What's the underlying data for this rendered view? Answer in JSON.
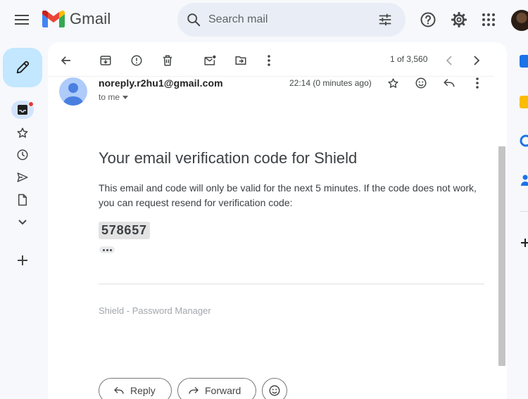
{
  "header": {
    "app_name": "Gmail",
    "search_placeholder": "Search mail"
  },
  "toolbar": {
    "counter": "1 of 3,560"
  },
  "message": {
    "sender": "noreply.r2hu1@gmail.com",
    "recipient_label": "to me",
    "timestamp": "22:14 (0 minutes ago)",
    "subject": "Your email verification code for Shield",
    "body": "This email and code will only be valid for the next 5 minutes. If the code does not work, you can request resend for verification code:",
    "code": "578657",
    "footer": "Shield - Password Manager"
  },
  "actions": {
    "reply_label": "Reply",
    "forward_label": "Forward"
  },
  "colors": {
    "page_bg": "#f6f8fc",
    "compose_bg": "#c2e7ff",
    "search_bg": "#e9eef6",
    "unread_dot": "#e53935"
  },
  "icons": [
    "menu-icon",
    "gmail-logo",
    "search-icon",
    "filter-icon",
    "help-icon",
    "settings-icon",
    "apps-icon",
    "compose-icon",
    "inbox-icon",
    "star-icon",
    "clock-icon",
    "send-icon",
    "file-icon",
    "chevron-down-icon",
    "plus-icon",
    "back-arrow-icon",
    "archive-icon",
    "report-spam-icon",
    "trash-icon",
    "mark-unread-icon",
    "move-to-icon",
    "more-vert-icon",
    "chevron-left-icon",
    "chevron-right-icon",
    "reply-icon",
    "forward-icon",
    "emoji-icon"
  ]
}
